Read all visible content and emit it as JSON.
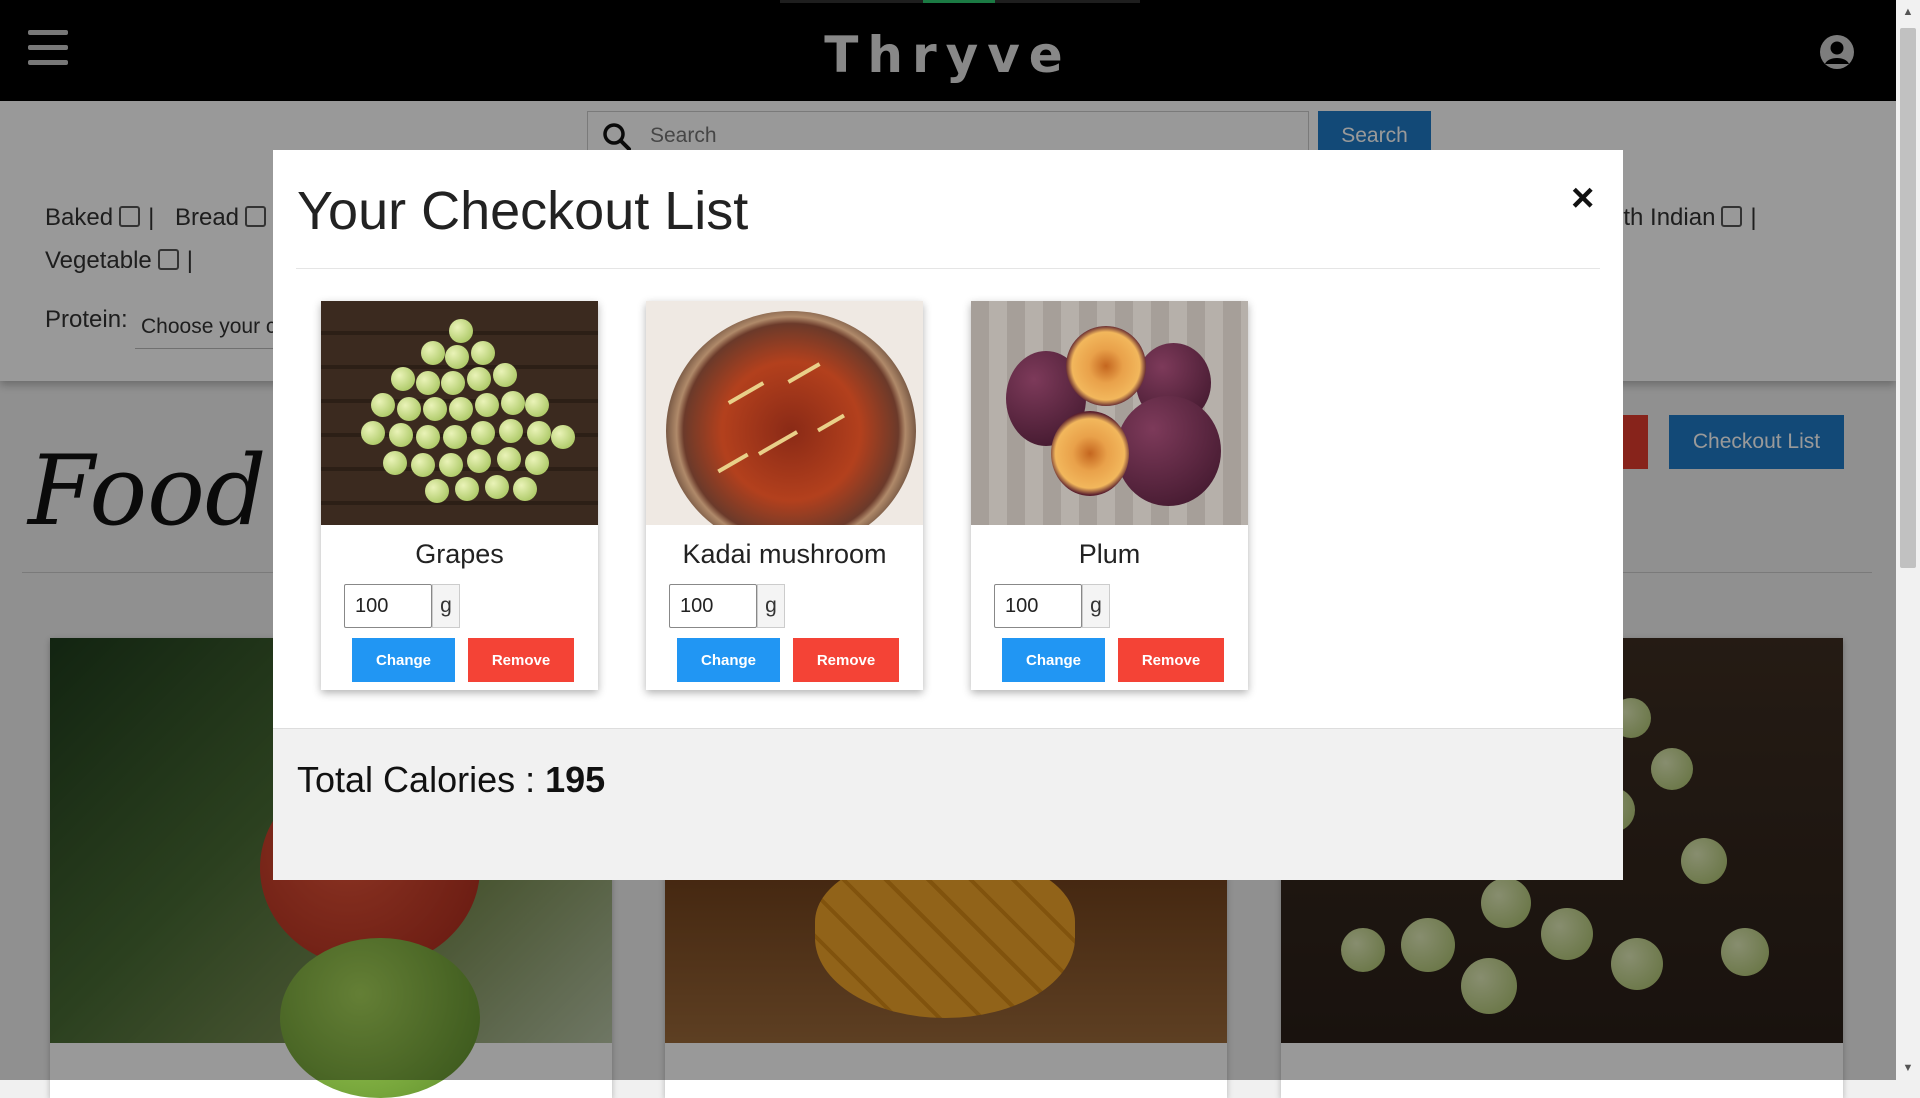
{
  "app": {
    "brand": "Thryve"
  },
  "search": {
    "placeholder": "Search",
    "button_label": "Search"
  },
  "filters": {
    "row1": [
      "Baked",
      "Bread"
    ],
    "row1_right": "uth Indian",
    "row2": [
      "Vegetable"
    ],
    "protein_label": "Protein:",
    "protein_placeholder": "Choose your c"
  },
  "page": {
    "title": "Food Ca",
    "checkout_button": "Checkout List"
  },
  "modal": {
    "title": "Your Checkout List",
    "close_label": "×",
    "items": [
      {
        "name": "Grapes",
        "quantity": "100",
        "unit": "g",
        "change_label": "Change",
        "remove_label": "Remove"
      },
      {
        "name": "Kadai mushroom",
        "quantity": "100",
        "unit": "g",
        "change_label": "Change",
        "remove_label": "Remove"
      },
      {
        "name": "Plum",
        "quantity": "100",
        "unit": "g",
        "change_label": "Change",
        "remove_label": "Remove"
      }
    ],
    "total_label": "Total Calories : ",
    "total_value": "195"
  },
  "colors": {
    "primary": "#2196f3",
    "danger": "#f44336",
    "navbar": "#000000",
    "search_button": "#1e7bc6"
  },
  "icons": [
    "hamburger-menu-icon",
    "user-account-icon",
    "search-icon",
    "close-icon"
  ]
}
